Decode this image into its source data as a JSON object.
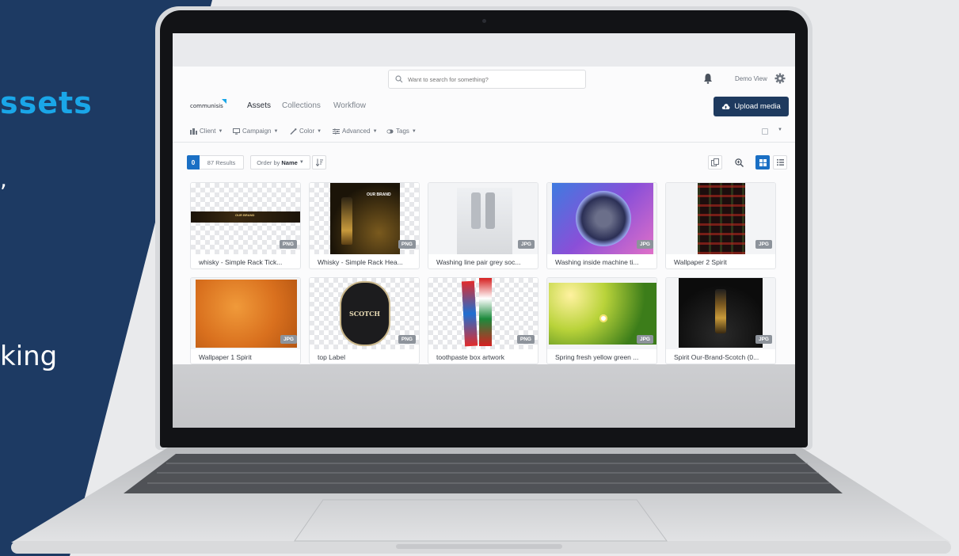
{
  "backdrop": {
    "title_fragment": "ssets",
    "comma_fragment": ",",
    "king_fragment": "king"
  },
  "app": {
    "search": {
      "placeholder": "Want to search for something?",
      "icon": "search-icon"
    },
    "header": {
      "notification_icon": "bell-icon",
      "user_label": "Demo View",
      "settings_icon": "gear-icon"
    },
    "logo_text": "communisis",
    "nav": {
      "tabs": [
        {
          "label": "Assets",
          "active": true
        },
        {
          "label": "Collections"
        },
        {
          "label": "Workflow"
        }
      ]
    },
    "upload_button": {
      "label": "Upload media",
      "icon": "cloud-upload-icon"
    },
    "filters": [
      {
        "label": "Client",
        "icon": "client-icon"
      },
      {
        "label": "Campaign",
        "icon": "monitor-icon"
      },
      {
        "label": "Color",
        "icon": "eyedropper-icon"
      },
      {
        "label": "Advanced",
        "icon": "sliders-icon"
      },
      {
        "label": "Tags",
        "icon": "toggle-icon"
      }
    ],
    "toolbar": {
      "selected_count": "0",
      "results": "87 Results",
      "order_prefix": "Order by",
      "order_value": "Name",
      "view_mode": "grid"
    },
    "assets": [
      {
        "name": "whisky - Simple Rack Tick...",
        "type": "PNG"
      },
      {
        "name": "Whisky - Simple Rack Hea...",
        "type": "PNG"
      },
      {
        "name": "Washing line pair grey soc...",
        "type": "JPG"
      },
      {
        "name": "Washing inside machine ti...",
        "type": "JPG"
      },
      {
        "name": "Wallpaper 2 Spirit",
        "type": "JPG"
      },
      {
        "name": "Wallpaper 1 Spirit",
        "type": "JPG"
      },
      {
        "name": "top Label",
        "type": "PNG"
      },
      {
        "name": "toothpaste box artwork",
        "type": "PNG"
      },
      {
        "name": "Spring fresh yellow green ...",
        "type": "JPG"
      },
      {
        "name": "Spirit Our-Brand-Scotch (0...",
        "type": "JPG"
      }
    ],
    "thumbnail_texts": {
      "banner_brand": "OUR BRAND",
      "bottle_brand": "OUR BRAND",
      "label_word": "SCOTCH"
    }
  },
  "colors": {
    "navy": "#1d3a63",
    "accent": "#1aa6e8",
    "button": "#1e3a5f",
    "active_blue": "#1a6fc4"
  }
}
